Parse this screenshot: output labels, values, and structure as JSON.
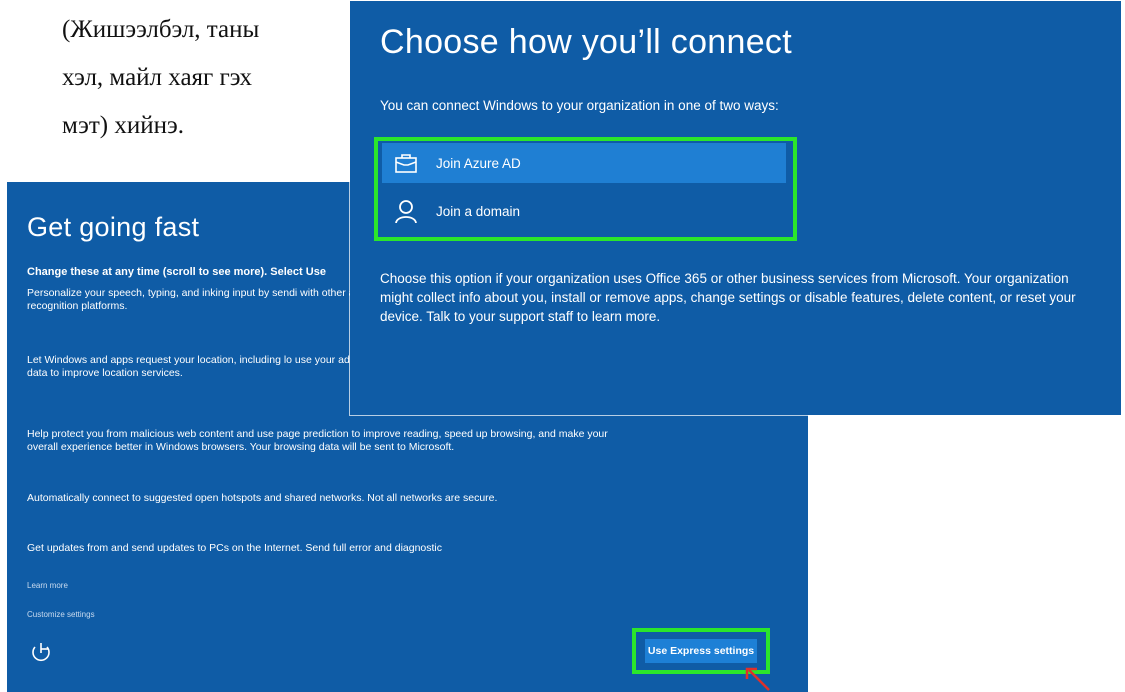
{
  "caption": {
    "lines": [
      "(Жишээлбэл, таны",
      "хэл, майл хаяг гэх",
      "мэт) хийнэ."
    ]
  },
  "get_going_fast": {
    "title": "Get going fast",
    "subhead": "Change these at any time (scroll to see more). Select Use",
    "paragraphs": [
      "Personalize your speech, typing, and inking input by sendi with other associated input data to Microsoft. Let Microso and recognition platforms.",
      "Let Windows and apps request your location, including lo use your advertising ID to personalize your experiences. S location data to improve location services.",
      "Help protect you from malicious web content and use page prediction to improve reading, speed up browsing, and make your overall experience better in Windows browsers. Your browsing data will be sent to Microsoft.",
      "Automatically connect to suggested open hotspots and shared networks. Not all networks are secure.",
      "Get updates from and send updates to PCs on the Internet. Send full error and diagnostic"
    ],
    "learn_more": "Learn more",
    "customize_settings": "Customize settings",
    "express_button": "Use Express settings",
    "accessibility_icon": "ease-of-access-icon"
  },
  "choose_connect": {
    "title": "Choose how you’ll connect",
    "intro": "You can connect Windows to your organization in one of two ways:",
    "options": [
      {
        "label": "Join Azure AD",
        "icon": "briefcase-icon",
        "selected": true
      },
      {
        "label": "Join a domain",
        "icon": "person-icon",
        "selected": false
      }
    ],
    "description": "Choose this option if your organization uses Office 365 or other business services from Microsoft. Your organization might collect info about you, install or remove apps, change settings or disable features, delete content, or reset your device. Talk to your support staff to learn more."
  },
  "colors": {
    "oobe_blue": "#0f5ca6",
    "selected_blue": "#1f7fd3",
    "highlight_green": "#2be62b",
    "cursor_red": "#e0302a"
  }
}
